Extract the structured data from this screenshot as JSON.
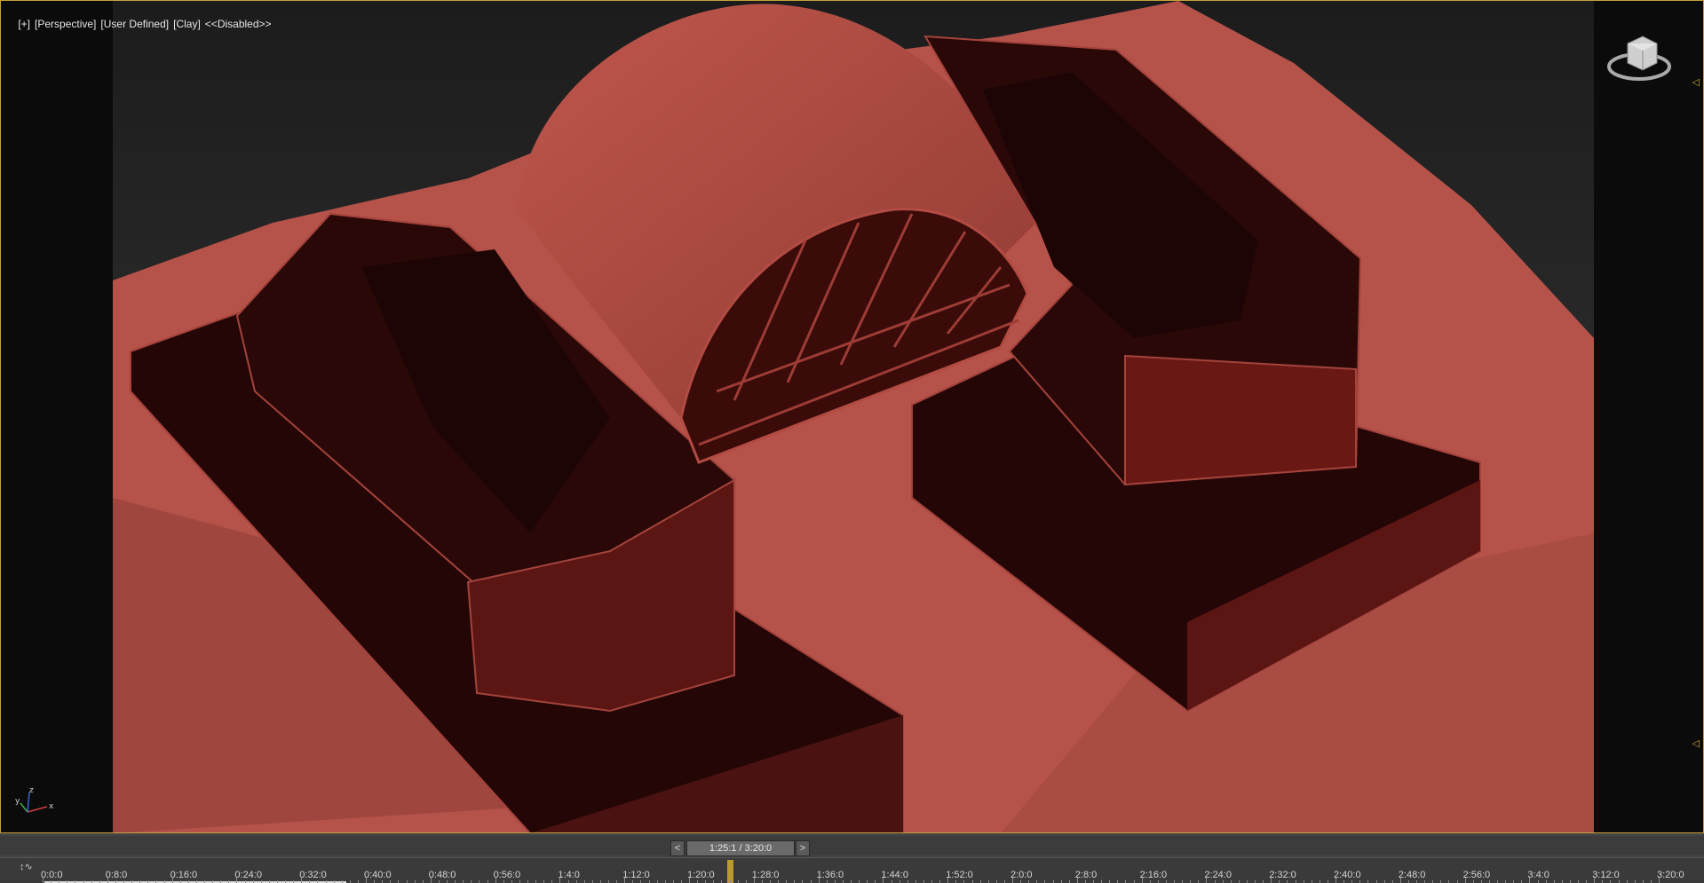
{
  "viewport": {
    "labels": [
      "[+]",
      "[Perspective]",
      "[User Defined]",
      "[Clay]",
      "<<Disabled>>"
    ],
    "view_name": "Perspective",
    "shading": "Clay"
  },
  "timeline": {
    "current_frame_text": "1:25:1 / 3:20:0",
    "prev_label": "<",
    "next_label": ">",
    "ticks": [
      "0:0:0",
      "0:8:0",
      "0:16:0",
      "0:24:0",
      "0:32:0",
      "0:40:0",
      "0:48:0",
      "0:56:0",
      "1:4:0",
      "1:12:0",
      "1:20:0",
      "1:28:0",
      "1:36:0",
      "1:44:0",
      "1:52:0",
      "2:0:0",
      "2:8:0",
      "2:16:0",
      "2:24:0",
      "2:32:0",
      "2:40:0",
      "2:48:0",
      "2:56:0",
      "3:4:0",
      "3:12:0",
      "3:20:0"
    ],
    "current_fraction": 0.4255
  },
  "colors": {
    "clay": "#b5524a",
    "building_dark": "#2a0707",
    "frame_border": "#c8a23a"
  },
  "icons": [
    "viewcube-icon",
    "axis-tripod-icon",
    "mini-curve-editor-icon"
  ]
}
